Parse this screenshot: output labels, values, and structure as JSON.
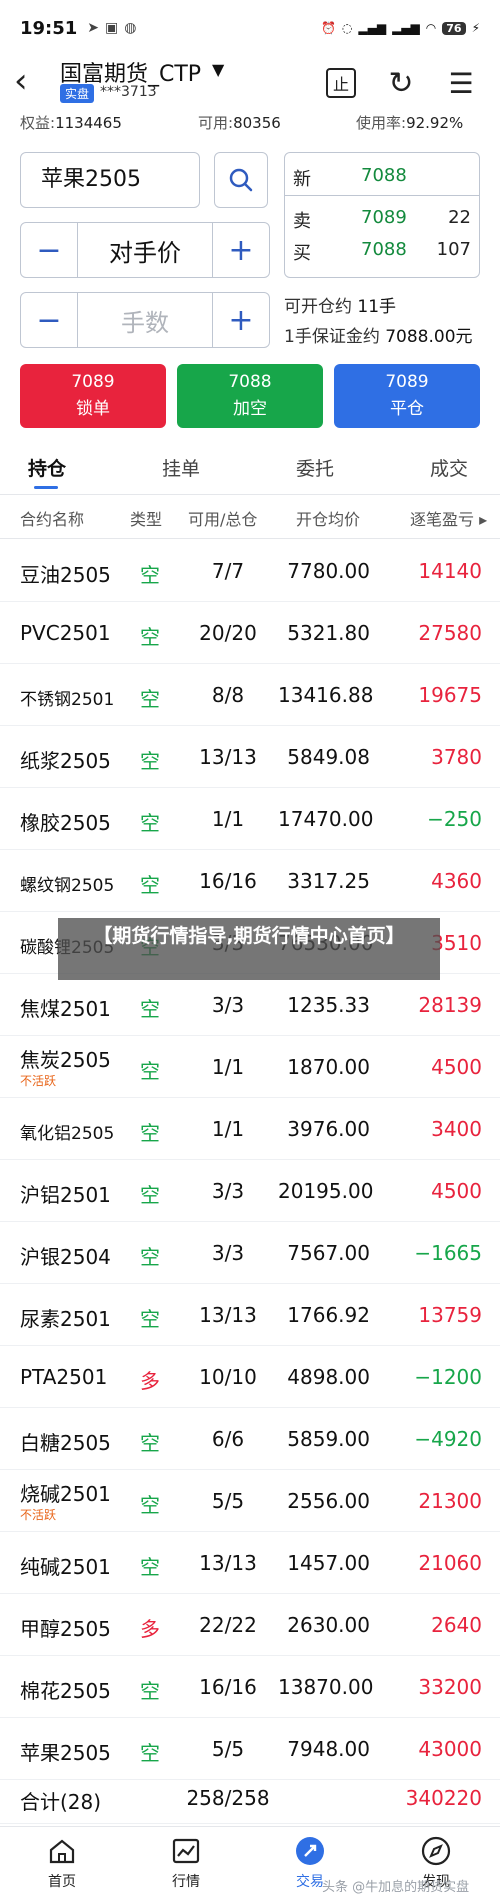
{
  "status_bar": {
    "time": "19:51",
    "battery": "76"
  },
  "header": {
    "account_name": "国富期货_CTP",
    "account_tag": "实盘",
    "account_id": "***3713",
    "stamp_icon_label": "止"
  },
  "summary": {
    "equity_label": "权益:",
    "equity_value": "1134465",
    "available_label": "可用:",
    "available_value": "80356",
    "usage_label": "使用率:",
    "usage_value": "92.92%"
  },
  "order": {
    "symbol": "苹果2505",
    "price_type": "对手价",
    "qty_placeholder": "手数",
    "quote": {
      "last_label": "新",
      "last_price": "7088",
      "ask_label": "卖",
      "ask_price": "7089",
      "ask_volume": "22",
      "bid_label": "买",
      "bid_price": "7088",
      "bid_volume": "107"
    },
    "openable_label": "可开仓约",
    "openable_value": "11手",
    "margin_label": "1手保证金约",
    "margin_value": "7088.00元",
    "buttons": {
      "lock_price": "7089",
      "lock_label": "锁单",
      "short_price": "7088",
      "short_label": "加空",
      "close_price": "7089",
      "close_label": "平仓"
    }
  },
  "tabs": [
    "持仓",
    "挂单",
    "委托",
    "成交"
  ],
  "table": {
    "headers": [
      "合约名称",
      "类型",
      "可用/总仓",
      "开仓均价",
      "逐笔盈亏 ▸"
    ],
    "rows": [
      {
        "name": "豆油2505",
        "type": "空",
        "qty": "7/7",
        "avg": "7780.00",
        "pnl": "14140"
      },
      {
        "name": "PVC2501",
        "type": "空",
        "qty": "20/20",
        "avg": "5321.80",
        "pnl": "27580"
      },
      {
        "name": "不锈钢2501",
        "type": "空",
        "qty": "8/8",
        "avg": "13416.88",
        "pnl": "19675"
      },
      {
        "name": "纸浆2505",
        "type": "空",
        "qty": "13/13",
        "avg": "5849.08",
        "pnl": "3780"
      },
      {
        "name": "橡胶2505",
        "type": "空",
        "qty": "1/1",
        "avg": "17470.00",
        "pnl": "−250"
      },
      {
        "name": "螺纹钢2505",
        "type": "空",
        "qty": "16/16",
        "avg": "3317.25",
        "pnl": "4360"
      },
      {
        "name": "碳酸锂2505",
        "type": "空",
        "qty": "3/3",
        "avg": "76530.00",
        "pnl": "3510"
      },
      {
        "name": "焦煤2501",
        "type": "空",
        "qty": "3/3",
        "avg": "1235.33",
        "pnl": "28139"
      },
      {
        "name": "焦炭2505",
        "tag": "不活跃",
        "type": "空",
        "qty": "1/1",
        "avg": "1870.00",
        "pnl": "4500"
      },
      {
        "name": "氧化铝2505",
        "type": "空",
        "qty": "1/1",
        "avg": "3976.00",
        "pnl": "3400"
      },
      {
        "name": "沪铝2501",
        "type": "空",
        "qty": "3/3",
        "avg": "20195.00",
        "pnl": "4500"
      },
      {
        "name": "沪银2504",
        "type": "空",
        "qty": "3/3",
        "avg": "7567.00",
        "pnl": "−1665"
      },
      {
        "name": "尿素2501",
        "type": "空",
        "qty": "13/13",
        "avg": "1766.92",
        "pnl": "13759"
      },
      {
        "name": "PTA2501",
        "type": "多",
        "qty": "10/10",
        "avg": "4898.00",
        "pnl": "−1200"
      },
      {
        "name": "白糖2505",
        "type": "空",
        "qty": "6/6",
        "avg": "5859.00",
        "pnl": "−4920"
      },
      {
        "name": "烧碱2501",
        "tag": "不活跃",
        "type": "空",
        "qty": "5/5",
        "avg": "2556.00",
        "pnl": "21300"
      },
      {
        "name": "纯碱2501",
        "type": "空",
        "qty": "13/13",
        "avg": "1457.00",
        "pnl": "21060"
      },
      {
        "name": "甲醇2505",
        "type": "多",
        "qty": "22/22",
        "avg": "2630.00",
        "pnl": "2640"
      },
      {
        "name": "棉花2505",
        "type": "空",
        "qty": "16/16",
        "avg": "13870.00",
        "pnl": "33200"
      },
      {
        "name": "苹果2505",
        "type": "空",
        "qty": "5/5",
        "avg": "7948.00",
        "pnl": "43000"
      }
    ],
    "total": {
      "label": "合计(28)",
      "qty": "258/258",
      "pnl": "340220"
    }
  },
  "banner": "【期货行情指导,期货行情中心首页】",
  "bottom_nav": [
    "首页",
    "行情",
    "交易",
    "发现"
  ],
  "watermark": "头条 @牛加息的期货实盘",
  "colors": {
    "accent": "#2f6fe4",
    "up": "#e8233d",
    "down": "#17a64a",
    "short_green": "#138a3d"
  }
}
